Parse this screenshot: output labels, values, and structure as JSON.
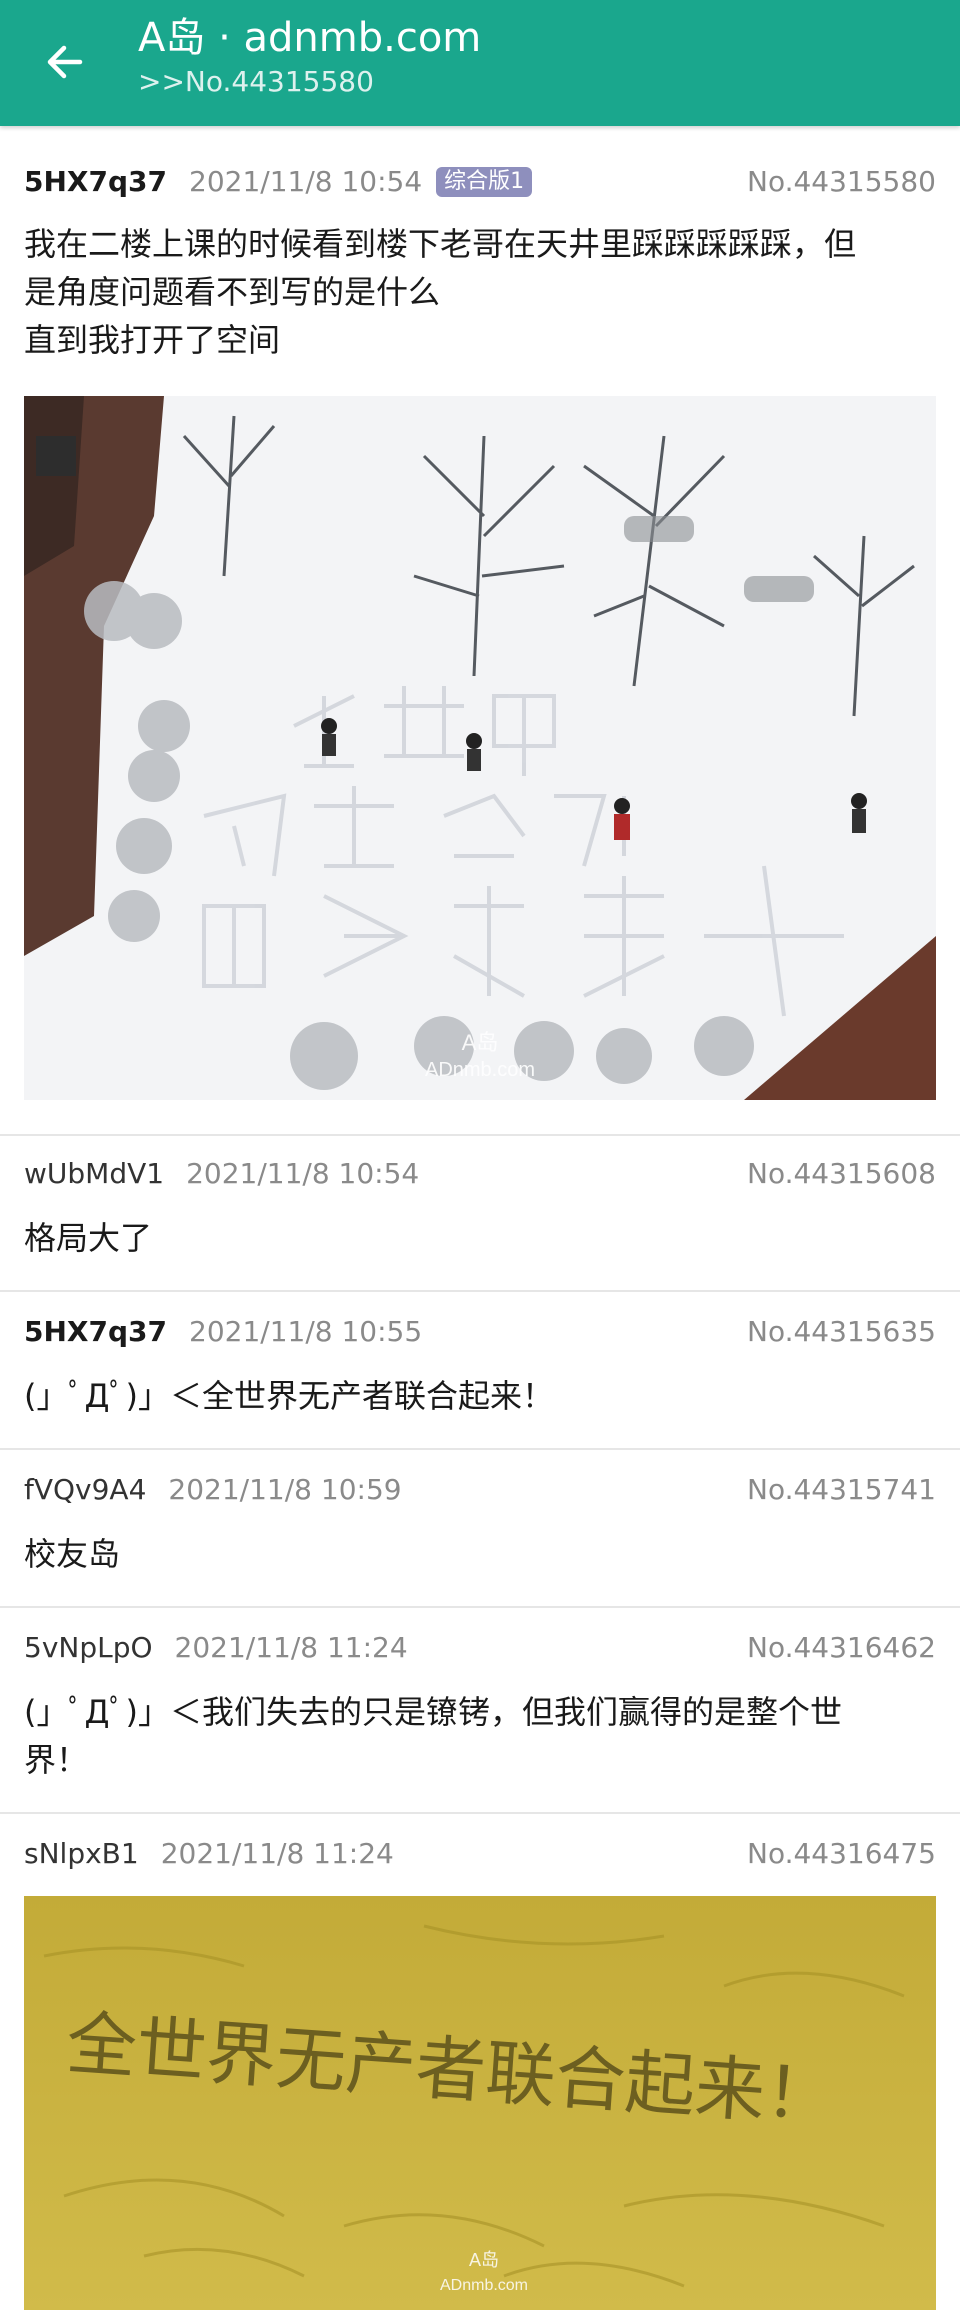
{
  "appbar": {
    "title": "A岛 · adnmb.com",
    "subtitle": ">>No.44315580"
  },
  "posts": [
    {
      "uid": "5HX7q37",
      "time": "2021/11/8 10:54",
      "badge": "综合版1",
      "no": "No.44315580",
      "lines": [
        "我在二楼上课的时候看到楼下老哥在天井里踩踩踩踩踩，但",
        "是角度问题看不到写的是什么",
        "直到我打开了空间"
      ],
      "image": {
        "snow_text": [
          "全",
          "世",
          "界",
          "无",
          "产",
          "阶",
          "级",
          "联",
          "合",
          "起",
          "来"
        ],
        "watermark": [
          "A岛",
          "ADnmb.com"
        ]
      }
    },
    {
      "uid": "wUbMdV1",
      "time": "2021/11/8 10:54",
      "no": "No.44315608",
      "lines": [
        "格局大了"
      ]
    },
    {
      "uid": "5HX7q37",
      "time": "2021/11/8 10:55",
      "no": "No.44315635",
      "lines": [
        "(」ﾟДﾟ)」＜全世界无产者联合起来！"
      ]
    },
    {
      "uid": "fVQv9A4",
      "time": "2021/11/8 10:59",
      "no": "No.44315741",
      "lines": [
        "校友岛"
      ]
    },
    {
      "uid": "5vNpLpO",
      "time": "2021/11/8 11:24",
      "no": "No.44316462",
      "lines": [
        "(」ﾟДﾟ)」＜我们失去的只是镣铐，但我们赢得的是整个世",
        "界！"
      ]
    },
    {
      "uid": "sNlpxB1",
      "time": "2021/11/8 11:24",
      "no": "No.44316475",
      "image": {
        "sand_text": "全世界无产者联合起来！",
        "watermark": [
          "A岛",
          "ADnmb.com"
        ]
      }
    }
  ],
  "colors": {
    "appbar": "#1aa78d",
    "badge": "#8e8fbd",
    "meta_gray": "#8a8a8a",
    "snow": "#f4f5f7",
    "sand": "#c9b23c"
  },
  "icons": {
    "back": "arrow-left-icon"
  }
}
